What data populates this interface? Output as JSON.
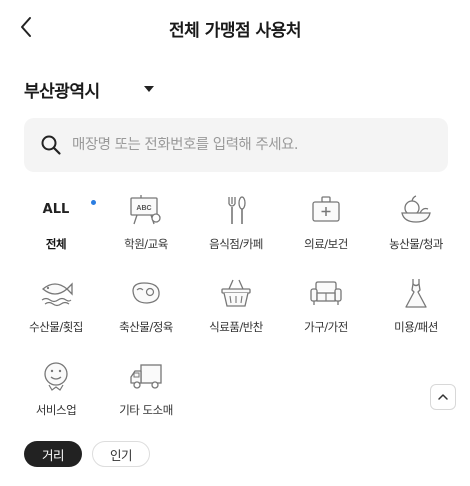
{
  "header": {
    "title": "전체 가맹점 사용처"
  },
  "region": {
    "selected": "부산광역시"
  },
  "search": {
    "placeholder": "매장명 또는 전화번호를 입력해 주세요.",
    "value": ""
  },
  "categories": [
    {
      "label": "전체",
      "icon": "all-icon",
      "icon_text": "ALL"
    },
    {
      "label": "학원/교육",
      "icon": "easel-abc-icon",
      "icon_text": "ABC"
    },
    {
      "label": "음식점/카페",
      "icon": "fork-knife-icon"
    },
    {
      "label": "의료/보건",
      "icon": "first-aid-kit-icon"
    },
    {
      "label": "농산물/청과",
      "icon": "fruit-bowl-icon"
    },
    {
      "label": "수산물/횟집",
      "icon": "fish-icon"
    },
    {
      "label": "축산물/정육",
      "icon": "meat-icon"
    },
    {
      "label": "식료품/반찬",
      "icon": "basket-icon"
    },
    {
      "label": "가구/가전",
      "icon": "sofa-icon"
    },
    {
      "label": "미용/패션",
      "icon": "dress-icon"
    },
    {
      "label": "서비스업",
      "icon": "smiley-face-icon"
    },
    {
      "label": "기타 도소매",
      "icon": "truck-icon"
    }
  ],
  "sort": {
    "options": [
      "거리",
      "인기"
    ],
    "selected": "거리"
  },
  "colors": {
    "accent_dot": "#2a7de1",
    "chip_active_bg": "#222222",
    "search_bg": "#f4f4f4"
  }
}
